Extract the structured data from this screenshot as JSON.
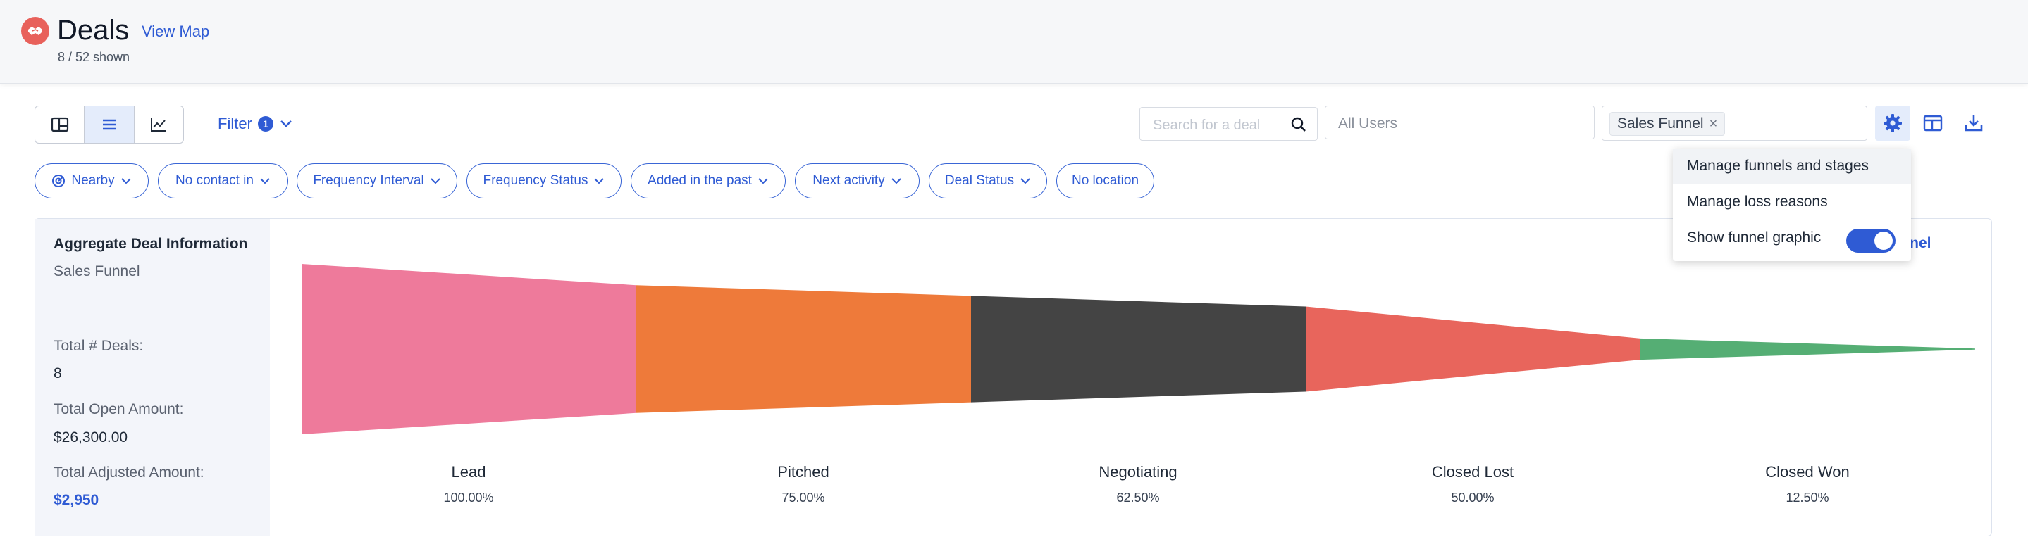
{
  "header": {
    "title": "Deals",
    "view_map": "View Map",
    "shown": "8 / 52 shown"
  },
  "toolbar": {
    "views": [
      "kanban-view",
      "list-view",
      "chart-view"
    ],
    "active_view": "list-view",
    "filter_label": "Filter",
    "filter_count": "1",
    "search_placeholder": "Search for a deal",
    "users_placeholder": "All Users",
    "funnel_tag": "Sales Funnel",
    "icons": [
      "gear-icon",
      "layout-columns-icon",
      "download-icon"
    ]
  },
  "chips": [
    {
      "label": "Nearby",
      "icon": "radar-icon"
    },
    {
      "label": "No contact in"
    },
    {
      "label": "Frequency Interval"
    },
    {
      "label": "Frequency Status"
    },
    {
      "label": "Added in the past"
    },
    {
      "label": "Next activity"
    },
    {
      "label": "Deal Status"
    },
    {
      "label": "No location"
    }
  ],
  "aggregate": {
    "title": "Aggregate Deal Information",
    "subtitle": "Sales Funnel",
    "total_deals_label": "Total # Deals:",
    "total_deals": "8",
    "open_amount_label": "Total Open Amount:",
    "open_amount": "$26,300.00",
    "adjusted_amount_label": "Total Adjusted Amount:",
    "adjusted_amount": "$2,950"
  },
  "edit_funnel_link": "e funnel",
  "funnel": {
    "stages": [
      {
        "name": "Lead",
        "percent_label": "100.00%",
        "percent": 100,
        "color": "#ee7a9b"
      },
      {
        "name": "Pitched",
        "percent_label": "75.00%",
        "percent": 75,
        "color": "#ee7a3a"
      },
      {
        "name": "Negotiating",
        "percent_label": "62.50%",
        "percent": 62.5,
        "color": "#444444"
      },
      {
        "name": "Closed Lost",
        "percent_label": "50.00%",
        "percent": 50,
        "color": "#e8655c"
      },
      {
        "name": "Closed Won",
        "percent_label": "12.50%",
        "percent": 12.5,
        "color": "#55ae74"
      }
    ]
  },
  "dropdown": {
    "items": [
      {
        "label": "Manage funnels and stages"
      },
      {
        "label": "Manage loss reasons"
      },
      {
        "label": "Show funnel graphic",
        "toggle": true
      }
    ]
  },
  "colors": {
    "accent": "#2f5bd4",
    "brand_icon": "#e8615b"
  }
}
